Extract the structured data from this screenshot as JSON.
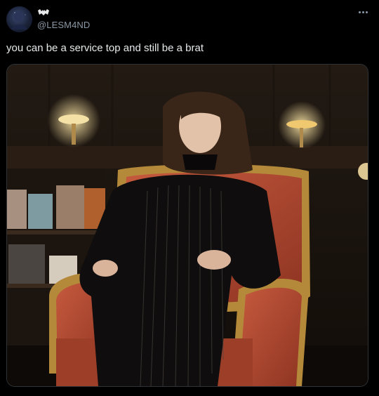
{
  "post": {
    "handle": "@LESM4ND",
    "text": "you can be a service top and still be a brat",
    "icons": {
      "avatar": "avatar-image",
      "badge": "bat-icon",
      "more": "more-options-icon"
    },
    "media": {
      "type": "image",
      "alt_subject": "man with long hair in dark pinstripe suit sitting in ornate red armchair"
    }
  }
}
